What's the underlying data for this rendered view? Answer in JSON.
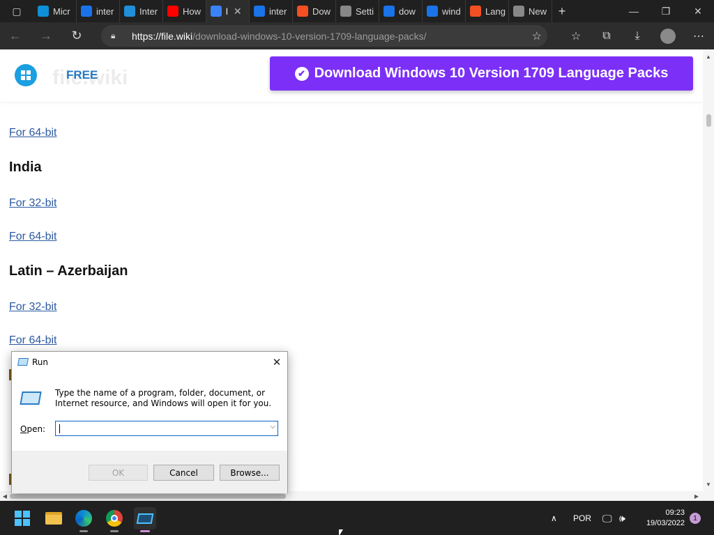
{
  "browser": {
    "tabs": [
      {
        "label": "Micr",
        "favicon": "edge-icon",
        "color": "#0f8fd8"
      },
      {
        "label": "inter",
        "favicon": "bing-icon",
        "color": "#1a73e8"
      },
      {
        "label": "Inter",
        "favicon": "plus-icon",
        "color": "#1f8fd8"
      },
      {
        "label": "How",
        "favicon": "youtube-icon",
        "color": "#ff0000"
      },
      {
        "label": "l",
        "favicon": "loading-icon",
        "color": "#3b82f6",
        "active": true
      },
      {
        "label": "inter",
        "favicon": "bing-icon",
        "color": "#1a73e8"
      },
      {
        "label": "Dow",
        "favicon": "microsoft-icon",
        "color": "#f25022"
      },
      {
        "label": "Setti",
        "favicon": "gear-icon",
        "color": "#888888"
      },
      {
        "label": "dow",
        "favicon": "bing-icon",
        "color": "#1a73e8"
      },
      {
        "label": "wind",
        "favicon": "bing-icon",
        "color": "#1a73e8"
      },
      {
        "label": "Lang",
        "favicon": "microsoft-icon",
        "color": "#f25022"
      },
      {
        "label": "New",
        "favicon": "newtab-icon",
        "color": "#888888"
      }
    ],
    "url_host": "https://file.wiki",
    "url_path": "/download-windows-10-version-1709-language-packs/"
  },
  "site": {
    "free_label": "FREE",
    "ghost_text": "file.wiki",
    "download_button": "Download Windows 10 Version 1709 Language Packs"
  },
  "content": {
    "link_64_top": "For 64-bit",
    "heading_india": "India",
    "india_32": "For 32-bit",
    "india_64": "For 64-bit",
    "heading_latin_az": "Latin – Azerbaijan",
    "latin_32": "For 32-bit",
    "latin_64": "For 64-bit"
  },
  "run_dialog": {
    "title": "Run",
    "description": "Type the name of a program, folder, document, or Internet resource, and Windows will open it for you.",
    "open_label_prefix": "",
    "open_label_u": "O",
    "open_label_rest": "pen:",
    "input_value": "",
    "ok_label": "OK",
    "cancel_label": "Cancel",
    "browse_label": "Browse..."
  },
  "taskbar": {
    "language": "POR",
    "time": "09:23",
    "date": "19/03/2022",
    "notification_count": "1"
  }
}
